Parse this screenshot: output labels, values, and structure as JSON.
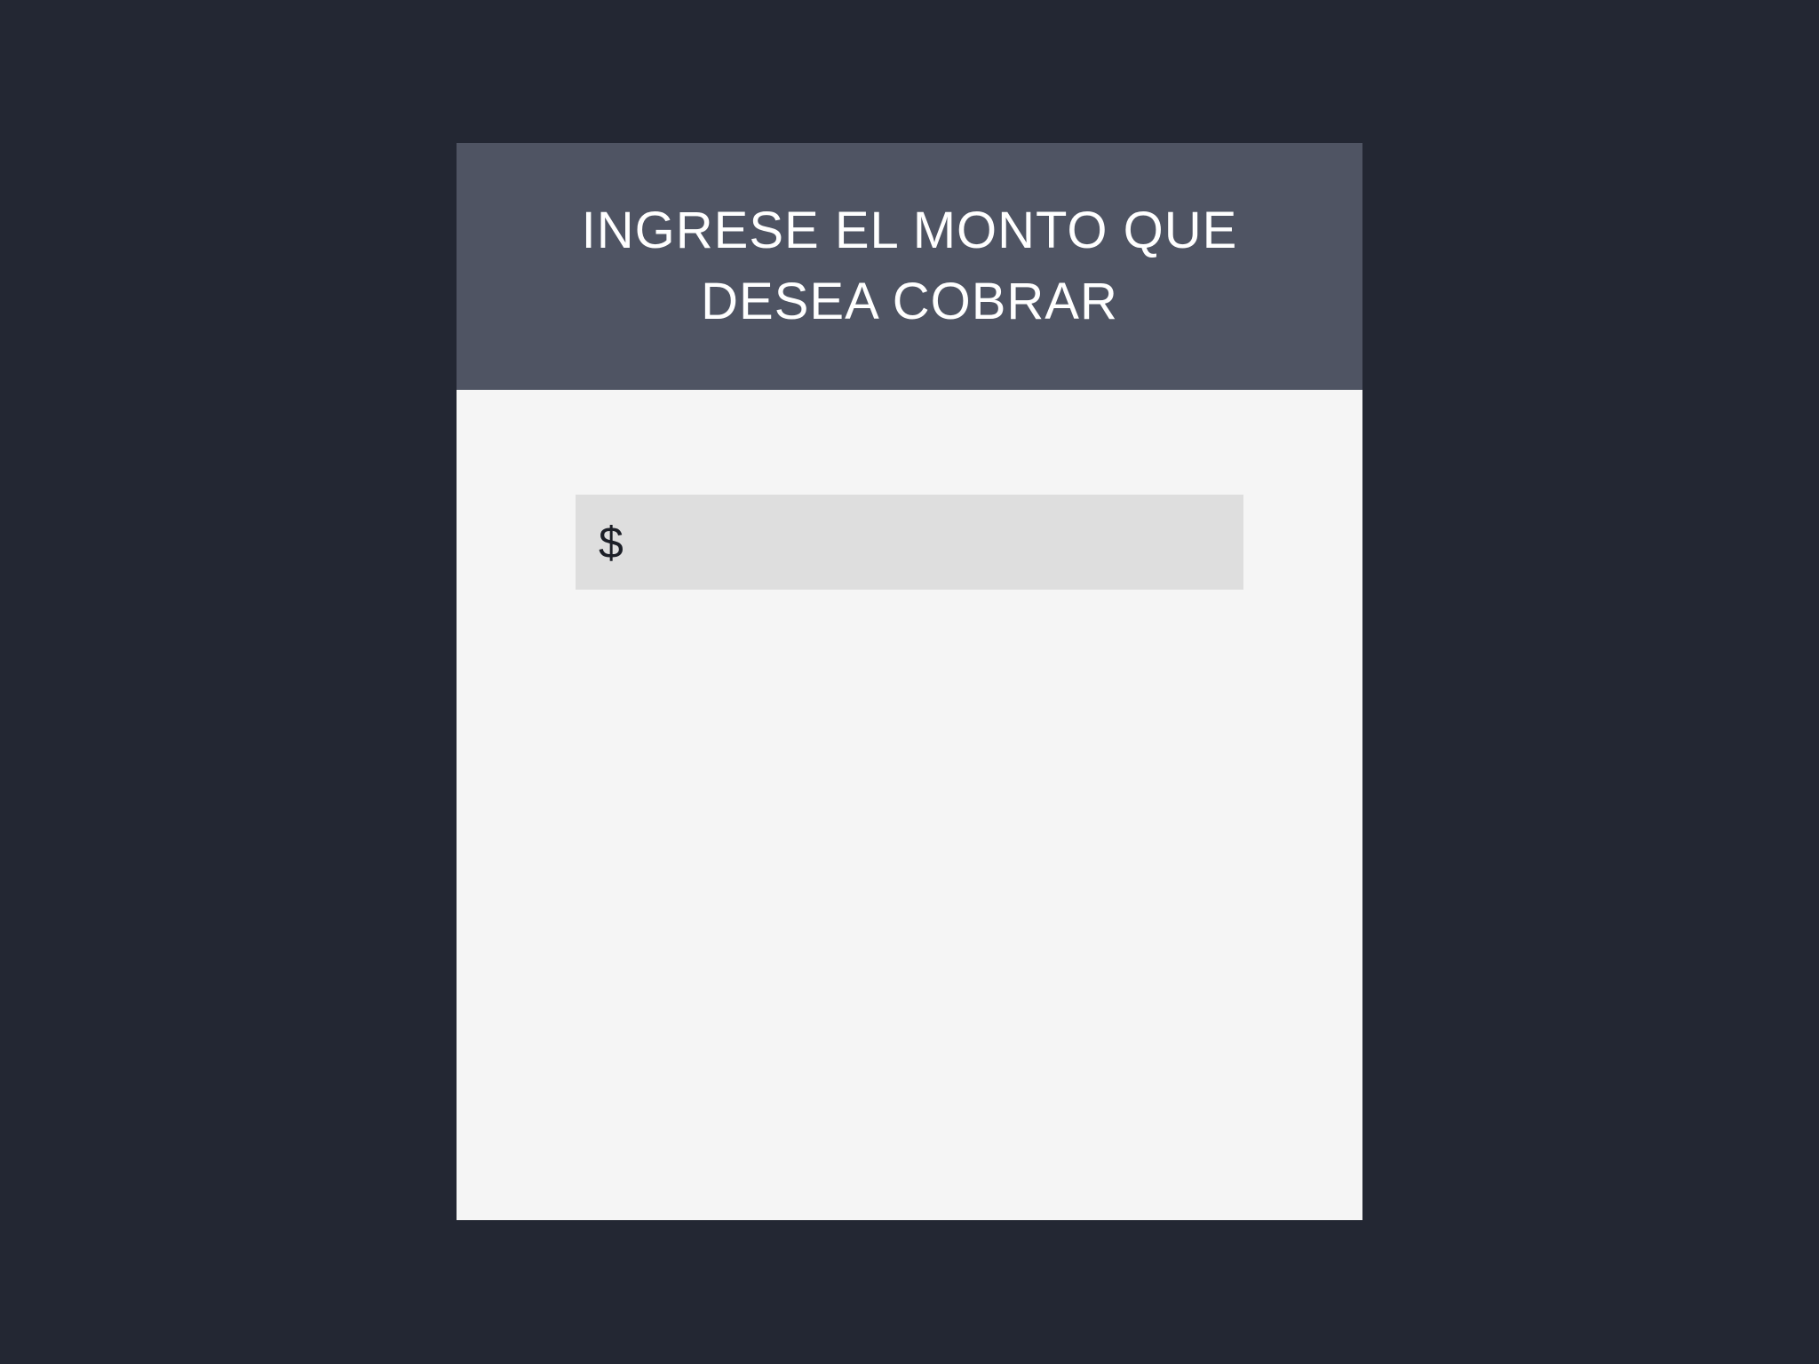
{
  "header": {
    "title": "INGRESE EL MONTO QUE DESEA COBRAR"
  },
  "amount": {
    "currency_symbol": "$",
    "value": "",
    "placeholder": ""
  },
  "colors": {
    "background": "#232733",
    "header_background": "#4f5463",
    "card_background": "#f5f5f5",
    "input_background": "#dedede",
    "header_text": "#ffffff",
    "input_text": "#1c1f27"
  }
}
